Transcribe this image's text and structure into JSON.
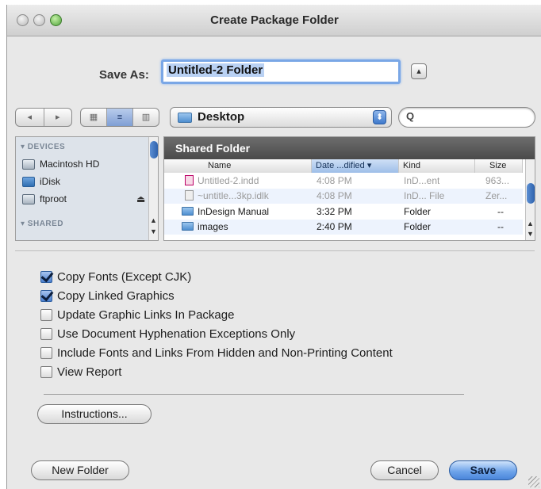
{
  "window": {
    "title": "Create Package Folder"
  },
  "save_as": {
    "label": "Save As:",
    "value": "Untitled-2 Folder",
    "expand_button": "▴"
  },
  "toolbar": {
    "back": "◂",
    "forward": "▸",
    "view_icons": "▦",
    "view_list": "≡",
    "view_columns": "▥",
    "location": "Desktop",
    "location_arrows": "⬍",
    "search_placeholder": "Q"
  },
  "sidebar": {
    "sections": [
      {
        "heading": "▾ DEVICES",
        "items": [
          {
            "label": "Macintosh HD",
            "icon": "hard-drive-icon"
          },
          {
            "label": "iDisk",
            "icon": "idisk-icon"
          },
          {
            "label": "ftproot",
            "icon": "network-drive-icon",
            "eject": "⏏"
          }
        ]
      },
      {
        "heading": "▾ SHARED",
        "items": []
      }
    ]
  },
  "file_list": {
    "path_title": "Shared Folder",
    "columns": [
      "Name",
      "Date ...dified ▾",
      "Kind",
      "Size"
    ],
    "rows": [
      {
        "name": "Untitled-2.indd",
        "date": "4:08 PM",
        "kind": "InD...ent",
        "size": "963...",
        "icon": "indd-file-icon",
        "dimmed": true
      },
      {
        "name": "~untitle...3kp.idlk",
        "date": "4:08 PM",
        "kind": "InD... File",
        "size": "Zer...",
        "icon": "lock-file-icon",
        "dimmed": true
      },
      {
        "name": "InDesign Manual",
        "date": "3:32 PM",
        "kind": "Folder",
        "size": "--",
        "icon": "folder-icon",
        "dimmed": false
      },
      {
        "name": "images",
        "date": "2:40 PM",
        "kind": "Folder",
        "size": "--",
        "icon": "folder-icon",
        "dimmed": false
      }
    ]
  },
  "options": [
    {
      "label": "Copy Fonts (Except CJK)",
      "checked": true
    },
    {
      "label": "Copy Linked Graphics",
      "checked": true
    },
    {
      "label": "Update Graphic Links In Package",
      "checked": false
    },
    {
      "label": "Use Document Hyphenation Exceptions Only",
      "checked": false
    },
    {
      "label": "Include Fonts and Links From Hidden and Non-Printing Content",
      "checked": false
    },
    {
      "label": "View Report",
      "checked": false
    }
  ],
  "buttons": {
    "instructions": "Instructions...",
    "new_folder": "New Folder",
    "cancel": "Cancel",
    "save": "Save"
  },
  "colors": {
    "accent": "#4a85da",
    "path_bar": "#5a5a5a",
    "sidebar_bg": "#dde3ea"
  }
}
